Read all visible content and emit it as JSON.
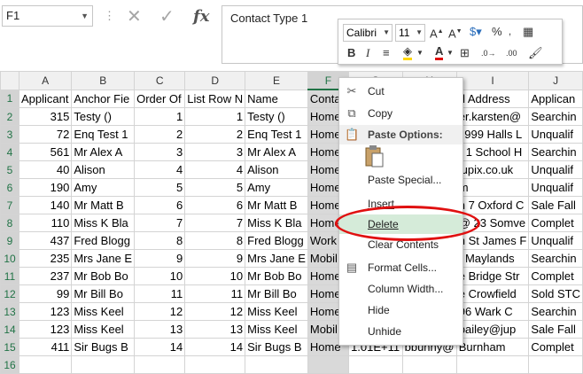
{
  "name_box": "F1",
  "formula_bar": {
    "content": "Contact Type 1",
    "cancel_icon": "✕",
    "enter_icon": "✓",
    "fx": "fx"
  },
  "mini_toolbar": {
    "font": "Calibri",
    "size": "11"
  },
  "columns": [
    "A",
    "B",
    "C",
    "D",
    "E",
    "F",
    "G",
    "H",
    "I",
    "J"
  ],
  "rows": [
    {
      "num": "1",
      "cells": [
        "Applicant",
        "Anchor Fie",
        "Order Of",
        "List Row N",
        "Name",
        "Contac",
        "",
        "",
        "d Address",
        "Applican"
      ]
    },
    {
      "num": "2",
      "cells": [
        "315",
        "Testy ()",
        "1",
        "1",
        "Testy ()",
        "Home",
        "",
        "",
        "er.karsten@",
        "Searchin"
      ]
    },
    {
      "num": "3",
      "cells": [
        "72",
        "Enq Test 1",
        "2",
        "2",
        "Enq Test 1",
        "Home",
        "",
        "",
        "l 999 Halls L",
        "Unqualif"
      ]
    },
    {
      "num": "4",
      "cells": [
        "561",
        "Mr Alex A",
        "3",
        "3",
        "Mr Alex A",
        "Home",
        "",
        "",
        "r 1 School H",
        "Searchin"
      ]
    },
    {
      "num": "5",
      "cells": [
        "40",
        "Alison",
        "4",
        "4",
        "Alison",
        "Home",
        "",
        "",
        "jupix.co.uk",
        "Unqualif"
      ]
    },
    {
      "num": "6",
      "cells": [
        "190",
        "Amy",
        "5",
        "5",
        "Amy",
        "Home",
        "",
        "",
        "m",
        "Unqualif"
      ]
    },
    {
      "num": "7",
      "cells": [
        "140",
        "Mr Matt B",
        "6",
        "6",
        "Mr Matt B",
        "Home",
        "",
        "",
        "h 7 Oxford C",
        "Sale Fall"
      ]
    },
    {
      "num": "8",
      "cells": [
        "110",
        "Miss K Bla",
        "7",
        "7",
        "Miss K Bla",
        "Home",
        "",
        "",
        "@ 23 Somve",
        "Complet"
      ]
    },
    {
      "num": "9",
      "cells": [
        "437",
        "Fred Blogg",
        "8",
        "8",
        "Fred Blogg",
        "Work",
        "",
        "",
        "h St James F",
        "Unqualif"
      ]
    },
    {
      "num": "10",
      "cells": [
        "235",
        "Mrs Jane E",
        "9",
        "9",
        "Mrs Jane E",
        "Mobil",
        "",
        "",
        "t Maylands",
        "Searchin"
      ]
    },
    {
      "num": "11",
      "cells": [
        "237",
        "Mr Bob Bo",
        "10",
        "10",
        "Mr Bob Bo",
        "Home",
        "",
        "",
        "e Bridge Str",
        "Complet"
      ]
    },
    {
      "num": "12",
      "cells": [
        "99",
        "Mr Bill Bo",
        "11",
        "11",
        "Mr Bill Bo",
        "Home",
        "",
        "",
        "e Crowfield",
        "Sold STC"
      ]
    },
    {
      "num": "13",
      "cells": [
        "123",
        "Miss Keel",
        "12",
        "12",
        "Miss Keel",
        "Home",
        "",
        "",
        "96 Wark C",
        "Searchin"
      ]
    },
    {
      "num": "14",
      "cells": [
        "123",
        "Miss Keel",
        "13",
        "13",
        "Miss Keel",
        "Mobil",
        "",
        "",
        "bailey@jup",
        "Sale Fall"
      ]
    },
    {
      "num": "15",
      "cells": [
        "411",
        "Sir Bugs B",
        "14",
        "14",
        "Sir Bugs B",
        "Home",
        "1.01E+11",
        "bbunny@",
        "Burnham",
        "Complet"
      ]
    },
    {
      "num": "16",
      "cells": [
        "",
        "",
        "",
        "",
        "",
        "",
        "",
        "",
        "",
        ""
      ]
    }
  ],
  "context_menu": {
    "cut": "Cut",
    "copy": "Copy",
    "paste_options": "Paste Options:",
    "paste_special": "Paste Special...",
    "insert": "Insert",
    "delete": "Delete",
    "clear_contents": "Clear Contents",
    "format_cells": "Format Cells...",
    "column_width": "Column Width...",
    "hide": "Hide",
    "unhide": "Unhide"
  },
  "colors": {
    "accent": "#217346",
    "highlight": "#d5ebd9",
    "annotation": "#e01010"
  }
}
